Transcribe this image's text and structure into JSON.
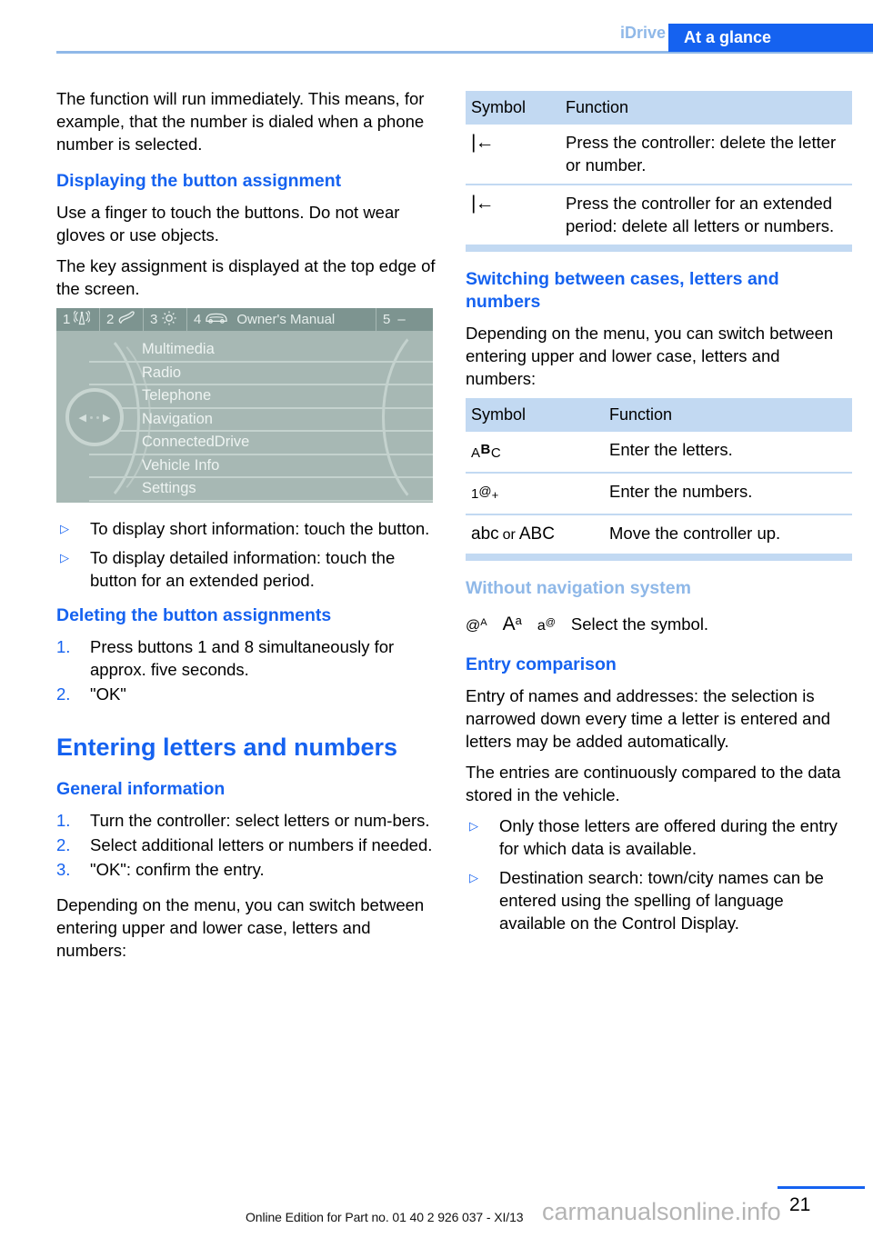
{
  "header": {
    "breadcrumb_section": "iDrive",
    "breadcrumb_chapter": "At a glance",
    "accent_color": "#1562f0",
    "rule_color": "#8fb8e8"
  },
  "left_column": {
    "intro_paragraph": "The function will run immediately. This means, for example, that the number is dialed when a phone number is selected.",
    "heading_displaying": "Displaying the button assignment",
    "para_touch": "Use a finger to touch the buttons. Do not wear gloves or use objects.",
    "para_key_assignment": "The key assignment is displayed at the top edge of the screen.",
    "figure": {
      "topbar": {
        "item1_number": "1",
        "item1_icon": "antenna-icon",
        "item2_number": "2",
        "item2_icon": "telephone-handset-icon",
        "item3_number": "3",
        "item3_icon": "gear-icon",
        "item4_number": "4",
        "item4_icon": "car-icon",
        "item4_title": "Owner's Manual",
        "item5_number": "5",
        "item5_dash": "–"
      },
      "menu_items": [
        "Multimedia",
        "Radio",
        "Telephone",
        "Navigation",
        "ConnectedDrive",
        "Vehicle Info",
        "Settings"
      ],
      "background_color": "#a7b8b4",
      "topbar_color": "#7d9490"
    },
    "bullets_display": [
      "To display short information: touch the button.",
      "To display detailed information: touch the button for an extended period."
    ],
    "heading_deleting": "Deleting the button assignments",
    "steps_deleting": [
      {
        "num": "1.",
        "text": "Press buttons 1 and 8 simultaneously for approx. five seconds."
      },
      {
        "num": "2.",
        "text": "\"OK\""
      }
    ],
    "chapter_title": "Entering letters and numbers",
    "heading_general": "General information",
    "steps_general": [
      {
        "num": "1.",
        "text": "Turn the controller: select letters or num-bers."
      },
      {
        "num": "2.",
        "text": "Select additional letters or numbers if needed."
      },
      {
        "num": "3.",
        "text": "\"OK\": confirm the entry."
      }
    ],
    "para_depending": "Depending on the menu, you can switch between entering upper and lower case, letters and numbers:"
  },
  "right_column": {
    "table_delete": {
      "head_symbol": "Symbol",
      "head_function": "Function",
      "rows": [
        {
          "symbol_name": "backspace-icon",
          "symbol": "|←",
          "function": "Press the controller: delete the letter or number."
        },
        {
          "symbol_name": "backspace-icon",
          "symbol": "|←",
          "function": "Press the controller for an extended period: delete all letters or numbers."
        }
      ]
    },
    "heading_switching": "Switching between cases, letters and numbers",
    "para_depending": "Depending on the menu, you can switch between entering upper and lower case, letters and numbers:",
    "table_switch": {
      "head_symbol": "Symbol",
      "head_function": "Function",
      "rows": [
        {
          "symbol_name": "abc-letters-icon",
          "symbol_main": "A",
          "symbol_sup": "B",
          "symbol_tail": "C",
          "function": "Enter the letters."
        },
        {
          "symbol_name": "numbers-icon",
          "symbol_main": "1",
          "symbol_sup": "@",
          "symbol_tail": "+",
          "function": "Enter the numbers."
        },
        {
          "symbol_name": "case-switch-icon",
          "symbol_lower": "abc",
          "symbol_or": "or",
          "symbol_upper": "ABC",
          "function": "Move the controller up."
        }
      ]
    },
    "heading_without_nav": "Without navigation system",
    "nav_symbols": [
      {
        "name": "at-upper-a-icon",
        "main": "@",
        "sup": "A"
      },
      {
        "name": "upper-a-lower-a-icon",
        "main": "A",
        "sup": "a"
      },
      {
        "name": "lower-a-at-icon",
        "main": "a",
        "sup": "@"
      }
    ],
    "nav_symbols_text": "Select the symbol.",
    "heading_entry_comparison": "Entry comparison",
    "para_entry_names": "Entry of names and addresses: the selection is narrowed down every time a letter is entered and letters may be added automatically.",
    "para_entries_compared": "The entries are continuously compared to the data stored in the vehicle.",
    "bullets_entry": [
      "Only those letters are offered during the entry for which data is available.",
      "Destination search: town/city names can be entered using the spelling of language available on the Control Display."
    ]
  },
  "footer": {
    "page_number": "21",
    "edition_note": "Online Edition for Part no. 01 40 2 926 037 - XI/13",
    "watermark": "carmanualsonline.info"
  }
}
